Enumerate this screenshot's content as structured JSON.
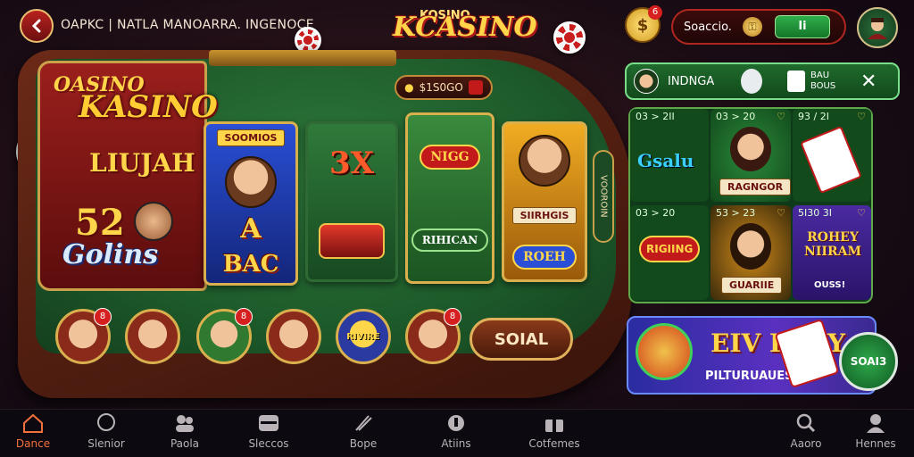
{
  "header": {
    "title": "OAPKC | NATLA MANOARRA. INGENOCE",
    "brand_top": "KOSINO",
    "brand": "KCASINO",
    "balance_label": "Soaccio.",
    "balance_button": "Ii",
    "coin_badge": "6"
  },
  "table": {
    "jackpot": "$1S0GO",
    "side_tag": "VOOROIN",
    "promo": {
      "logo_line1": "OASINO",
      "logo_line2": "KASINO",
      "subtitle": "LIUJAH",
      "number": "52",
      "coins": "Golins"
    },
    "games": [
      {
        "top_label": "SOOMIOS",
        "middle": "A",
        "bottom": "BAC"
      },
      {
        "word": "3X"
      },
      {
        "word": "NIGG",
        "badge": "RIHICAN"
      },
      {
        "tag": "SIIRHGIS",
        "badge": "ROEH"
      }
    ],
    "avatars": [
      {
        "badge": "8"
      },
      {
        "badge": ""
      },
      {
        "badge": "8"
      },
      {
        "badge": ""
      },
      {
        "label": "RIVIRE"
      },
      {
        "badge": "8"
      }
    ],
    "social_button": "SOIAL"
  },
  "notification": {
    "name": "INDNGA",
    "meta_line1": "BAU",
    "meta_line2": "BOUS"
  },
  "grid": {
    "cells": [
      {
        "head": "03 > 2II",
        "word": "Gsalu"
      },
      {
        "head": "03 > 20",
        "tag": "RAGNGOR"
      },
      {
        "head": "93 / 2I"
      },
      {
        "head": "03 > 20",
        "word": "RIGIING"
      },
      {
        "head": "53 > 23",
        "tag": "GUARIIE"
      },
      {
        "head": "5I30 3I",
        "word": "ROHEY NIIRAM",
        "sub": "OUSS!"
      }
    ]
  },
  "banner": {
    "title": "EIV PMIY",
    "subtitle": "PILTURUAUES",
    "play_button": "SOAI3"
  },
  "nav": [
    {
      "label": "Dance",
      "icon": "home-icon"
    },
    {
      "label": "Slenior",
      "icon": "chat-icon"
    },
    {
      "label": "Paola",
      "icon": "users-icon"
    },
    {
      "label": "Sleccos",
      "icon": "slot-icon"
    },
    {
      "label": "Bope",
      "icon": "pen-icon"
    },
    {
      "label": "Atiins",
      "icon": "drop-icon"
    },
    {
      "label": "Cotfemes",
      "icon": "gift-icon"
    },
    {
      "label": "Aaoro",
      "icon": "search-icon"
    },
    {
      "label": "Hennes",
      "icon": "profile-icon"
    }
  ],
  "colors": {
    "accent": "#f2703a",
    "felt": "#1d5a2a",
    "gold": "#d9b04d"
  }
}
